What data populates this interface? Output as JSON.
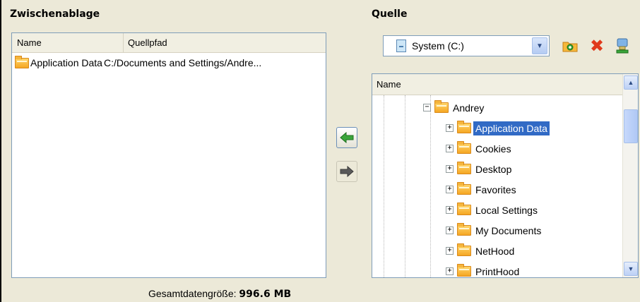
{
  "clipboard": {
    "title": "Zwischenablage",
    "columns": {
      "name": "Name",
      "source_path": "Quellpfad"
    },
    "rows": [
      {
        "name": "Application Data",
        "path": "C:/Documents and Settings/Andre..."
      }
    ],
    "total_label": "Gesamtdatengröße:",
    "total_value": "996.6 MB"
  },
  "source": {
    "title": "Quelle",
    "drive": {
      "selected": "System (C:)"
    },
    "tree_column": "Name",
    "tree": {
      "parent": "Andrey",
      "children": [
        {
          "label": "Application Data",
          "selected": true
        },
        {
          "label": "Cookies"
        },
        {
          "label": "Desktop"
        },
        {
          "label": "Favorites"
        },
        {
          "label": "Local Settings"
        },
        {
          "label": "My Documents"
        },
        {
          "label": "NetHood"
        },
        {
          "label": "PrintHood"
        }
      ]
    }
  },
  "icons": {
    "left_arrow": "arrow-left-icon",
    "right_arrow": "arrow-right-icon",
    "new_folder": "new-folder-icon",
    "delete": "delete-icon",
    "network": "network-drive-icon"
  },
  "colors": {
    "selection": "#316ac5",
    "arrow_green": "#3aa53a",
    "delete_red": "#e03a1c"
  }
}
